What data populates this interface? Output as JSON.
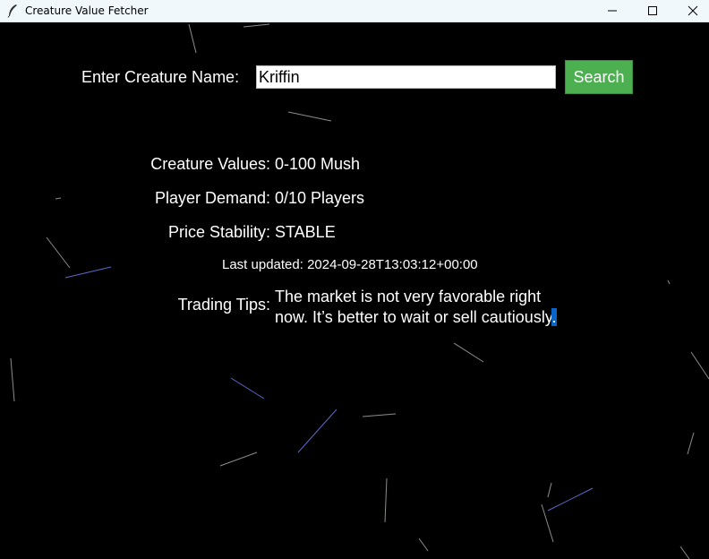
{
  "window": {
    "title": "Creature Value Fetcher",
    "app_icon": "feather-icon",
    "controls": [
      "minimize-icon",
      "maximize-icon",
      "close-icon"
    ]
  },
  "search": {
    "label": "Enter Creature Name:",
    "value": "Kriffin",
    "button_label": "Search",
    "button_color": "#4caf50"
  },
  "results": {
    "values_label": "Creature Values:",
    "values_value": "0-100 Mush",
    "demand_label": "Player Demand:",
    "demand_value": "0/10 Players",
    "stability_label": "Price Stability:",
    "stability_value": "STABLE",
    "last_updated": "Last updated: 2024-09-28T13:03:12+00:00",
    "tips_label": "Trading Tips:",
    "tips_text_line1": "The market is not very favorable right",
    "tips_text_line2": "now. It’s better to wait or sell cautiously",
    "tips_text_end": "."
  },
  "colors": {
    "background": "#000000",
    "text": "#ffffff",
    "selection": "#0a64c8"
  }
}
